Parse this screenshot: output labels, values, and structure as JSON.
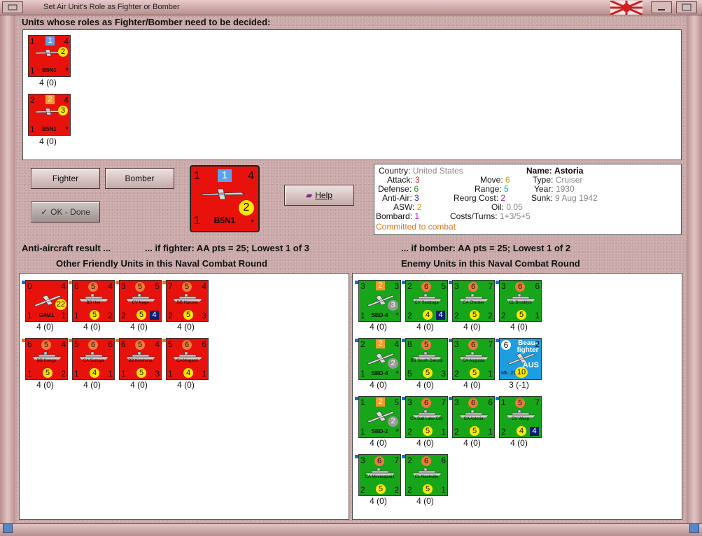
{
  "window": {
    "title": "Set Air Unit's Role as Fighter or Bomber"
  },
  "labels": {
    "undecided": "Units whose roles as Fighter/Bomber need to be decided:",
    "aa_result": "Anti-aircraft result ...",
    "if_fighter": "... if fighter:  AA pts = 25; Lowest 1 of 3",
    "if_bomber": "... if bomber:  AA pts = 25; Lowest 1 of 2",
    "friendly_header": "Other Friendly Units in this Naval Combat Round",
    "enemy_header": "Enemy Units in this Naval Combat Round"
  },
  "buttons": {
    "fighter": "Fighter",
    "bomber": "Bomber",
    "ok": "OK - Done",
    "help": "Help"
  },
  "undecided_units": [
    {
      "name": "B5N1",
      "tl": "1",
      "tr": "4",
      "bl": "1",
      "br": "*",
      "top": "1",
      "circle": "2",
      "count": "4 (0)",
      "topcolor": "blue"
    },
    {
      "name": "B5N1",
      "tl": "2",
      "tr": "4",
      "bl": "1",
      "br": "*",
      "top": "2",
      "circle": "3",
      "count": "4 (0)",
      "topcolor": "orange"
    }
  ],
  "selected_unit": {
    "name": "B5N1",
    "tl": "1",
    "tr": "4",
    "bl": "1",
    "br": "*",
    "top": "1",
    "circle": "2"
  },
  "info": {
    "country_k": "Country:",
    "country_v": "United States",
    "attack_k": "Attack:",
    "attack_v": "3",
    "defense_k": "Defense:",
    "defense_v": "6",
    "aa_k": "Anti-Air:",
    "aa_v": "3",
    "asw_k": "ASW:",
    "asw_v": "2",
    "bombard_k": "Bombard:",
    "bombard_v": "1",
    "committed": "Committed to combat",
    "move_k": "Move:",
    "move_v": "6",
    "range_k": "Range:",
    "range_v": "5",
    "reorg_k": "Reorg Cost:",
    "reorg_v": "2",
    "oil_k": "Oil:",
    "oil_v": "0.05",
    "costs_k": "Costs/Turns:",
    "costs_v": "1+3/5+5",
    "name_k": "Name:",
    "name_v": "Astoria",
    "type_k": "Type:",
    "type_v": "Cruiser",
    "year_k": "Year:",
    "year_v": "1930",
    "sunk_k": "Sunk:",
    "sunk_v": "9 Aug 1942"
  },
  "friendly_units": [
    {
      "name": "G4M1",
      "tl": "0",
      "tr": "4",
      "bl": "1",
      "br": "1",
      "circle": "22",
      "count": "4 (0)",
      "kind": "air"
    },
    {
      "name": "BB Hiei",
      "tl": "6",
      "tr": "4",
      "bl": "1",
      "br": "2",
      "top": "5",
      "circle": "5",
      "count": "4 (0)",
      "kind": "ship"
    },
    {
      "name": "CV Kaga",
      "tl": "3",
      "tr": "5",
      "bl": "2",
      "br": "",
      "top": "5",
      "circle": "5",
      "navy": "4",
      "count": "4 (0)",
      "kind": "ship"
    },
    {
      "name": "BB Haruna",
      "tl": "7",
      "tr": "4",
      "bl": "2",
      "br": "3",
      "top": "5",
      "circle": "5",
      "count": "4 (0)",
      "kind": "ship"
    },
    {
      "name": "BB Kongo",
      "tl": "6",
      "tr": "4",
      "bl": "1",
      "br": "2",
      "top": "5",
      "circle": "5",
      "count": "4 (0)",
      "kind": "ship"
    },
    {
      "name": "CA Suzuya",
      "tl": "5",
      "tr": "6",
      "bl": "1",
      "br": "1",
      "top": "6",
      "circle": "4",
      "count": "4 (0)",
      "kind": "ship"
    },
    {
      "name": "BB Kirishima",
      "tl": "6",
      "tr": "4",
      "bl": "1",
      "br": "3",
      "top": "5",
      "circle": "5",
      "count": "4 (0)",
      "kind": "ship"
    },
    {
      "name": "CA Mogami",
      "tl": "5",
      "tr": "6",
      "bl": "1",
      "br": "1",
      "top": "6",
      "circle": "4",
      "count": "4 (0)",
      "kind": "ship"
    }
  ],
  "enemy_units": [
    {
      "name": "SBD-4",
      "tl": "3",
      "tr": "3",
      "bl": "1",
      "br": "*",
      "top": "2",
      "gray": "3",
      "count": "4 (0)",
      "kind": "air"
    },
    {
      "name": "CV Saratoga",
      "tl": "2",
      "tr": "5",
      "bl": "2",
      "br": "",
      "top": "6",
      "circle": "4",
      "navy": "4",
      "count": "4 (0)",
      "kind": "ship"
    },
    {
      "name": "CA Chester",
      "tl": "3",
      "tr": "7",
      "bl": "2",
      "br": "2",
      "top": "6",
      "circle": "5",
      "count": "4 (0)",
      "kind": "ship"
    },
    {
      "name": "CL Brooklyn",
      "tl": "3",
      "tr": "6",
      "bl": "2",
      "br": "1",
      "top": "6",
      "circle": "5",
      "count": "4 (0)",
      "kind": "ship"
    },
    {
      "name": "SBD-4",
      "tl": "2",
      "tr": "4",
      "bl": "1",
      "br": "*",
      "top": "2",
      "gray": "2",
      "count": "4 (0)",
      "kind": "air"
    },
    {
      "name": "BB South Dakota",
      "tl": "8",
      "tr": "",
      "bl": "5",
      "br": "3",
      "top": "5",
      "circle": "5",
      "count": "4 (0)",
      "kind": "ship"
    },
    {
      "name": "CA Augusta",
      "tl": "3",
      "tr": "7",
      "bl": "2",
      "br": "1",
      "top": "6",
      "circle": "5",
      "count": "4 (0)",
      "kind": "ship"
    },
    {
      "name": "Beau-fighter",
      "tl": "6",
      "tr": "2",
      "bl": "Mk. 21",
      "br": "AUS",
      "circle": "10",
      "count": "3 (-1)",
      "kind": "aus"
    },
    {
      "name": "SBD-2",
      "tl": "1",
      "tr": "5",
      "bl": "1",
      "br": "*",
      "top": "2",
      "gray": "2",
      "count": "4 (0)",
      "kind": "air"
    },
    {
      "name": "CA Salt Lake City",
      "tl": "3",
      "tr": "7",
      "bl": "2",
      "br": "1",
      "top": "6",
      "circle": "5",
      "count": "4 (0)",
      "kind": "ship"
    },
    {
      "name": "CA Astoria",
      "tl": "3",
      "tr": "6",
      "bl": "2",
      "br": "1",
      "top": "6",
      "circle": "5",
      "count": "4 (0)",
      "kind": "ship"
    },
    {
      "name": "CV Wasp",
      "tl": "1",
      "tr": "7",
      "bl": "2",
      "br": "",
      "top": "5",
      "circle": "4",
      "navy": "4",
      "count": "4 (0)",
      "kind": "ship"
    },
    {
      "name": "CA Minneapolis",
      "tl": "3",
      "tr": "7",
      "bl": "2",
      "br": "2",
      "top": "6",
      "circle": "5",
      "count": "4 (0)",
      "kind": "ship"
    },
    {
      "name": "CL Nashville",
      "tl": "2",
      "tr": "6",
      "bl": "2",
      "br": "1",
      "top": "6",
      "circle": "5",
      "count": "4 (0)",
      "kind": "ship"
    }
  ]
}
